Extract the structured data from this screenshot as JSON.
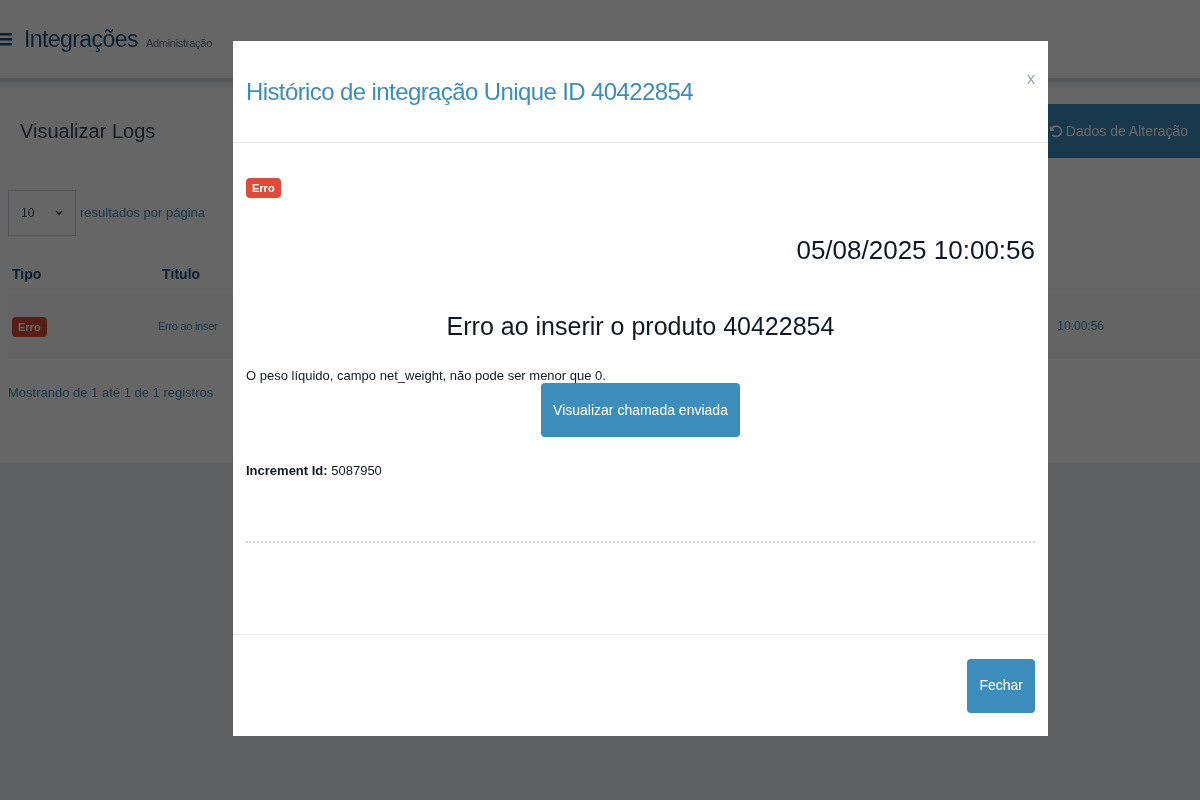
{
  "header": {
    "title": "Integrações",
    "subtitle": "Administração"
  },
  "panel": {
    "title": "Visualizar Logs",
    "action_button": "Dados de Alteração"
  },
  "page_size": {
    "value": "10",
    "label": "resultados por página"
  },
  "table": {
    "columns": [
      "Tipo",
      "Título"
    ],
    "rows": [
      {
        "type": {
          "label": "Erro",
          "kind": "error"
        },
        "title": "Erro ao inser",
        "date": "10:00:56"
      }
    ]
  },
  "info": "Mostrando de 1 até 1 de 1 registros",
  "modal": {
    "title": "Histórico de integração Unique ID 40422854",
    "close": "x",
    "status": {
      "label": "Erro",
      "kind": "error"
    },
    "datetime": "05/08/2025 10:00:56",
    "heading": "Erro ao inserir o produto 40422854",
    "message": "O peso líquido, campo net_weight, não pode ser menor que 0.",
    "view_button": "Visualizar chamada enviada",
    "increment": "**Increment Id:** 5087950",
    "footer_button": "Fechar"
  }
}
